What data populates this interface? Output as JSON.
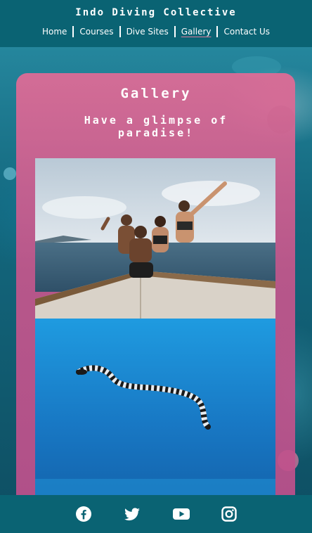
{
  "site": {
    "title": "Indo Diving Collective"
  },
  "nav": {
    "items": [
      {
        "label": "Home"
      },
      {
        "label": "Courses"
      },
      {
        "label": "Dive Sites"
      },
      {
        "label": "Gallery"
      },
      {
        "label": "Contact Us"
      }
    ],
    "active": "Gallery"
  },
  "gallery": {
    "title": "Gallery",
    "subtitle": "Have a glimpse of paradise!",
    "photos": [
      {
        "subject": "group-photo-on-boat"
      },
      {
        "subject": "sea-snake-underwater"
      }
    ]
  },
  "footer": {
    "icons": [
      "facebook-icon",
      "twitter-icon",
      "youtube-icon",
      "instagram-icon"
    ]
  },
  "colors": {
    "header_bg": "#0a6373",
    "card_pink": "#e26b96",
    "link_active_underline": "#e07a9a"
  }
}
